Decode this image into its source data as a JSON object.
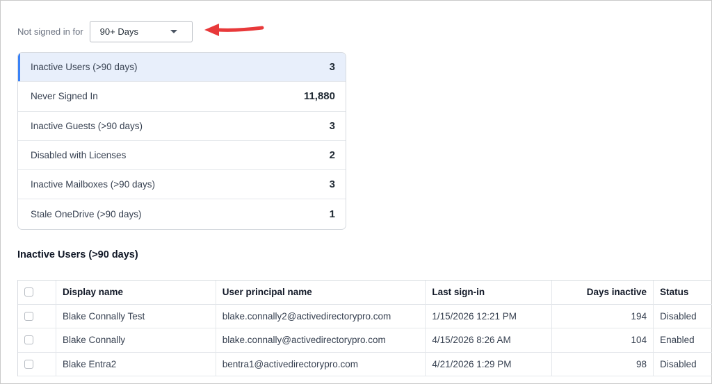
{
  "filter": {
    "label": "Not signed in for",
    "selected": "90+ Days"
  },
  "stats": [
    {
      "label": "Inactive Users (>90 days)",
      "value": "3"
    },
    {
      "label": "Never Signed In",
      "value": "11,880"
    },
    {
      "label": "Inactive Guests (>90 days)",
      "value": "3"
    },
    {
      "label": "Disabled with Licenses",
      "value": "2"
    },
    {
      "label": "Inactive Mailboxes (>90 days)",
      "value": "3"
    },
    {
      "label": "Stale OneDrive (>90 days)",
      "value": "1"
    }
  ],
  "section_title": "Inactive Users (>90 days)",
  "table": {
    "headers": [
      "Display name",
      "User principal name",
      "Last sign-in",
      "Days inactive",
      "Status"
    ],
    "rows": [
      [
        "Blake Connally Test",
        "blake.connally2@activedirectorypro.com",
        "1/15/2026 12:21 PM",
        "194",
        "Disabled"
      ],
      [
        "Blake Connally",
        "blake.connally@activedirectorypro.com",
        "4/15/2026 8:26 AM",
        "104",
        "Enabled"
      ],
      [
        "Blake Entra2",
        "bentra1@activedirectorypro.com",
        "4/21/2026 1:29 PM",
        "98",
        "Disabled"
      ]
    ]
  },
  "colors": {
    "accent": "#3b82f6",
    "active_row_bg": "#e8effb",
    "annotation_arrow": "#e8393a"
  },
  "icons": {
    "dropdown": "chevron-down-icon",
    "annotation": "red-arrow-icon"
  }
}
